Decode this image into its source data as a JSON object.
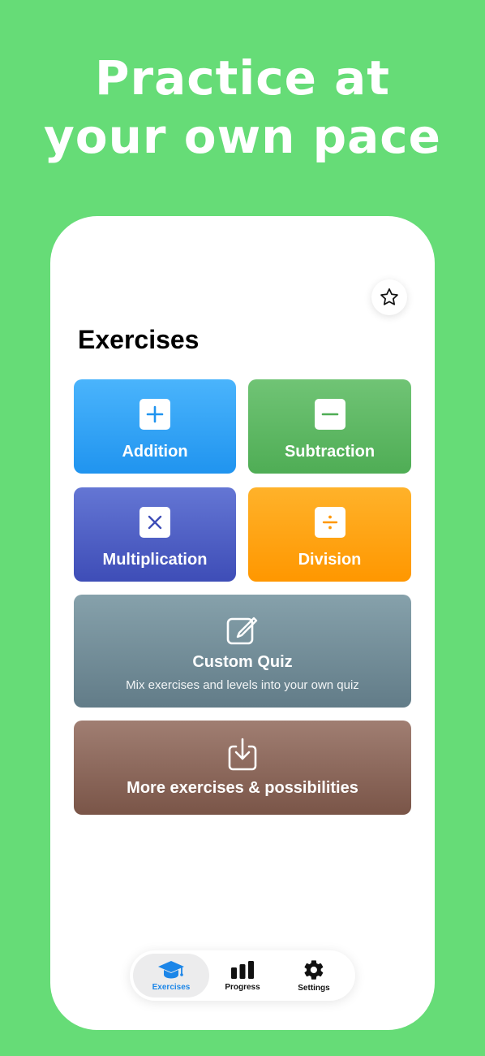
{
  "headline": {
    "line1": "Practice at",
    "line2": "your own pace"
  },
  "colors": {
    "background": "#66dc77",
    "addition": "#2094ef",
    "subtraction": "#4fad55",
    "multiplication": "#3e4db7",
    "division": "#ff9700",
    "custom_quiz": "#627c88",
    "more": "#7a5548",
    "active_tab": "#1c86e8"
  },
  "header": {
    "favorites_icon": "star-icon"
  },
  "main": {
    "title": "Exercises",
    "tiles": [
      {
        "label": "Addition",
        "icon": "plus-icon"
      },
      {
        "label": "Subtraction",
        "icon": "minus-icon"
      },
      {
        "label": "Multiplication",
        "icon": "multiply-icon"
      },
      {
        "label": "Division",
        "icon": "divide-icon"
      }
    ],
    "custom_quiz": {
      "label": "Custom Quiz",
      "subtitle": "Mix exercises and levels into your own quiz",
      "icon": "edit-icon"
    },
    "more": {
      "label": "More exercises & possibilities",
      "icon": "download-icon"
    }
  },
  "tabbar": {
    "tabs": [
      {
        "label": "Exercises",
        "icon": "graduation-cap-icon",
        "active": true
      },
      {
        "label": "Progress",
        "icon": "bar-chart-icon",
        "active": false
      },
      {
        "label": "Settings",
        "icon": "gear-icon",
        "active": false
      }
    ]
  }
}
